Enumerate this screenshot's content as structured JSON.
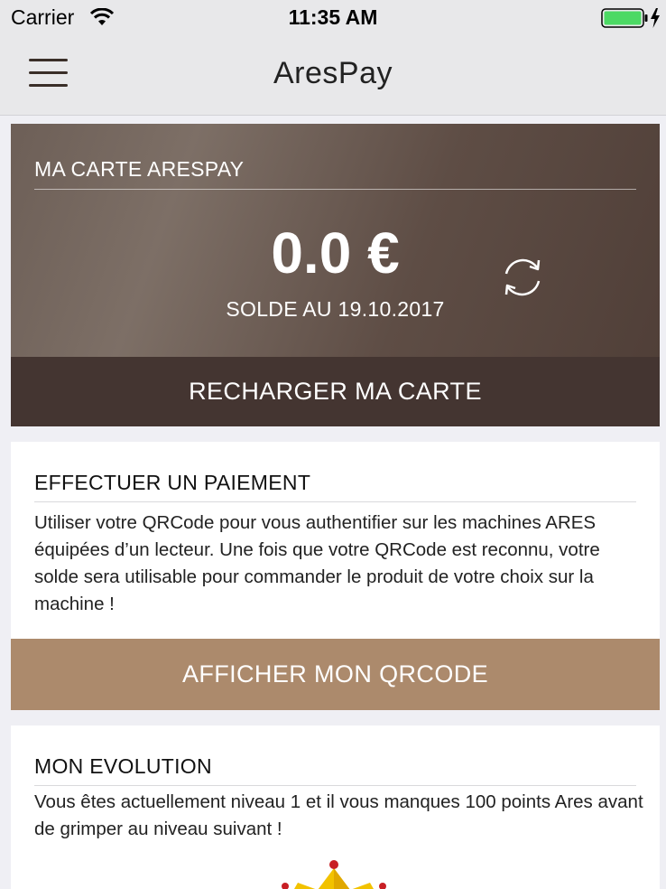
{
  "status_bar": {
    "carrier": "Carrier",
    "time": "11:35 AM",
    "wifi_icon": "wifi-icon",
    "battery_icon": "battery-charging-icon",
    "battery_color": "#4cd964"
  },
  "nav": {
    "title": "AresPay",
    "menu_icon": "hamburger-menu-icon"
  },
  "card": {
    "header": "MA CARTE ARESPAY",
    "balance": "0.0 €",
    "balance_date": "SOLDE AU 19.10.2017",
    "refresh_icon": "refresh-icon",
    "recharge_label": "RECHARGER MA CARTE"
  },
  "payment": {
    "title": "EFFECTUER UN PAIEMENT",
    "description": "Utiliser votre QRCode pour vous authentifier sur les machines ARES équipées d’un lecteur. Une fois que votre QRCode est reconnu, votre solde sera utilisable pour commander le produit de votre choix sur la machine !",
    "button_label": "AFFICHER MON QRCODE"
  },
  "evolution": {
    "title": "MON EVOLUTION",
    "description": "Vous êtes actuellement niveau 1 et il vous manques 100 points Ares avant de grimper au niveau suivant !",
    "level_icon": "crown-icon"
  },
  "colors": {
    "recharge_button": "#443531",
    "qr_button": "#ac8a6c",
    "card_gradient_start": "#7d6f66",
    "card_gradient_end": "#4f3e37"
  }
}
